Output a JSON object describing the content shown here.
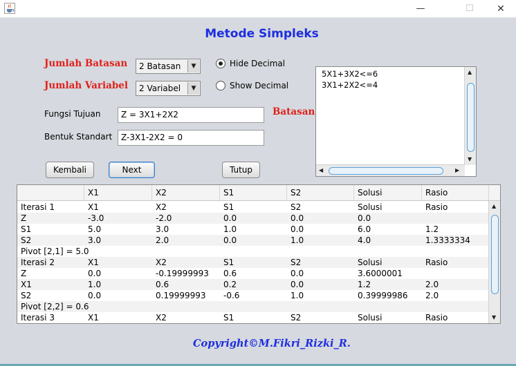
{
  "window": {
    "icon": "java-cup-icon",
    "minimize_glyph": "—",
    "maximize_glyph": "☐",
    "close_glyph": "✕"
  },
  "title": "Metode Simpleks",
  "labels": {
    "jumlah_batasan": "Jumlah Batasan",
    "jumlah_variabel": "Jumlah Variabel",
    "fungsi_tujuan": "Fungsi Tujuan",
    "bentuk_standart": "Bentuk Standart",
    "batasan": "Batasan"
  },
  "combos": {
    "batasan_value": "2 Batasan",
    "variabel_value": "2 Variabel",
    "arrow": "▼"
  },
  "radios": {
    "hide_decimal": "Hide Decimal",
    "show_decimal": "Show Decimal"
  },
  "fields": {
    "fungsi_tujuan": "Z = 3X1+2X2",
    "bentuk_standart": "Z-3X1-2X2 = 0"
  },
  "constraints": [
    "5X1+3X2<=6",
    "3X1+2X2<=4"
  ],
  "buttons": {
    "kembali": "Kembali",
    "next": "Next",
    "tutup": "Tutup"
  },
  "scroll_glyphs": {
    "up": "▲",
    "down": "▼",
    "left": "◀",
    "right": "▶"
  },
  "table": {
    "headers": [
      "",
      "X1",
      "X2",
      "S1",
      "S2",
      "Solusi",
      "Rasio"
    ],
    "rows": [
      [
        "Iterasi 1",
        "X1",
        "X2",
        "S1",
        "S2",
        "Solusi",
        "Rasio"
      ],
      [
        "Z",
        "-3.0",
        "-2.0",
        "0.0",
        "0.0",
        "0.0",
        ""
      ],
      [
        "S1",
        "5.0",
        "3.0",
        "1.0",
        "0.0",
        "6.0",
        "1.2"
      ],
      [
        "S2",
        "3.0",
        "2.0",
        "0.0",
        "1.0",
        "4.0",
        "1.3333334"
      ],
      [
        "Pivot [2,1] = 5.0",
        "",
        "",
        "",
        "",
        "",
        ""
      ],
      [
        "Iterasi 2",
        "X1",
        "X2",
        "S1",
        "S2",
        "Solusi",
        "Rasio"
      ],
      [
        "Z",
        "0.0",
        "-0.19999993",
        "0.6",
        "0.0",
        "3.6000001",
        ""
      ],
      [
        "X1",
        "1.0",
        "0.6",
        "0.2",
        "0.0",
        "1.2",
        "2.0"
      ],
      [
        "S2",
        "0.0",
        "0.19999993",
        "-0.6",
        "1.0",
        "0.39999986",
        "2.0"
      ],
      [
        "Pivot [2,2] = 0.6",
        "",
        "",
        "",
        "",
        "",
        ""
      ],
      [
        "Iterasi 3",
        "X1",
        "X2",
        "S1",
        "S2",
        "Solusi",
        "Rasio"
      ]
    ]
  },
  "copyright": "Copyright©M.Fikri_Rizki_R."
}
